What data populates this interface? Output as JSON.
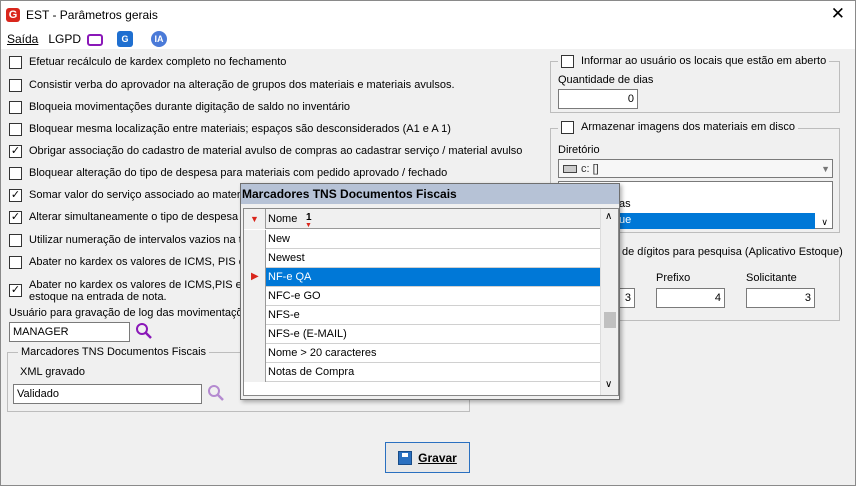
{
  "window": {
    "title": "EST - Parâmetros gerais",
    "close": "✕"
  },
  "menu": {
    "saida": "Saída",
    "lgpd": "LGPD",
    "icon2": "G",
    "icon3": "IA"
  },
  "options": [
    {
      "label": "Efetuar recálculo de kardex completo no fechamento",
      "checked": false
    },
    {
      "label": "Consistir verba do aprovador na alteração de grupos dos materiais e materiais avulsos.",
      "checked": false
    },
    {
      "label": "Bloqueia movimentações durante digitação de saldo no inventário",
      "checked": false
    },
    {
      "label": "Bloquear mesma localização entre materiais; espaços são desconsiderados (A1 e A 1)",
      "checked": false
    },
    {
      "label": "Obrigar associação do cadastro de material avulso de compras ao cadastrar serviço / material avulso",
      "checked": true
    },
    {
      "label": "Bloquear alteração do tipo de despesa para materiais com pedido aprovado / fechado",
      "checked": false
    },
    {
      "label": "Somar valor do serviço associado ao materia",
      "checked": true
    },
    {
      "label": "Alterar simultaneamente o tipo de despesa d",
      "checked": true
    },
    {
      "label": "Utilizar numeração de intervalos vazios na tra",
      "checked": false
    },
    {
      "label": "Abater no kardex os valores de ICMS, PIS e",
      "checked": false
    },
    {
      "label": "Abater no kardex os valores de ICMS,PIS e I",
      "label2": "estoque na entrada de nota.",
      "checked": true
    }
  ],
  "log_user": {
    "label": "Usuário para gravação de log das movimentaçõe",
    "value": "MANAGER"
  },
  "tns_group": {
    "legend": "Marcadores TNS Documentos Fiscais",
    "xml_label": "XML gravado",
    "xml_value": "Validado"
  },
  "right": {
    "informar_label": "Informar ao usuário os locais que estão em aberto",
    "dias_label": "Quantidade de dias",
    "dias_value": "0",
    "armazenar_label": "Armazenar imagens dos materiais em disco",
    "diretorio_label": "Diretório",
    "diretorio_value": "c: []",
    "list_items": [
      "as",
      "ue"
    ],
    "digitos_label": "de dígitos para pesquisa (Aplicativo Estoque)",
    "prefixo_label": "Prefixo",
    "prefixo_value": "4",
    "solicitante_label": "Solicitante",
    "solicitante_value": "3",
    "first_value": "3"
  },
  "popup": {
    "title": "Marcadores TNS Documentos Fiscais",
    "column": "Nome",
    "sort_index": "1",
    "rows": [
      "New",
      "Newest",
      "NF-e QA",
      "NFC-e GO",
      "NFS-e",
      "NFS-e (E-MAIL)",
      "Nome > 20 caracteres",
      "Notas de Compra"
    ],
    "selected_index": 2
  },
  "buttons": {
    "gravar": "Gravar"
  },
  "colors": {
    "selection": "#0078d7",
    "popup_title": "#b6c2d6",
    "accent_red": "#d9261c"
  }
}
